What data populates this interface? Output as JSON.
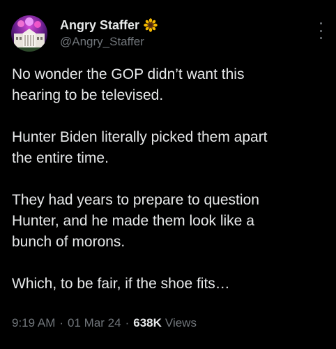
{
  "author": {
    "display_name": "Angry Staffer",
    "badge_icon": "sunflower-icon",
    "handle": "@Angry_Staffer"
  },
  "tweet": {
    "paragraphs": [
      "No wonder the GOP didn’t want this\nhearing to be televised.",
      "Hunter Biden literally picked them apart\nthe entire time.",
      "They had years to prepare to question\nHunter, and he made them look like a\nbunch of morons.",
      "Which, to be fair, if the shoe fits…"
    ],
    "time": "9:19 AM",
    "date": "01 Mar 24",
    "separator": "·",
    "views_count": "638K",
    "views_label": "Views"
  },
  "colors": {
    "background": "#000000",
    "text": "#e7e9ea",
    "secondary": "#71767b"
  }
}
